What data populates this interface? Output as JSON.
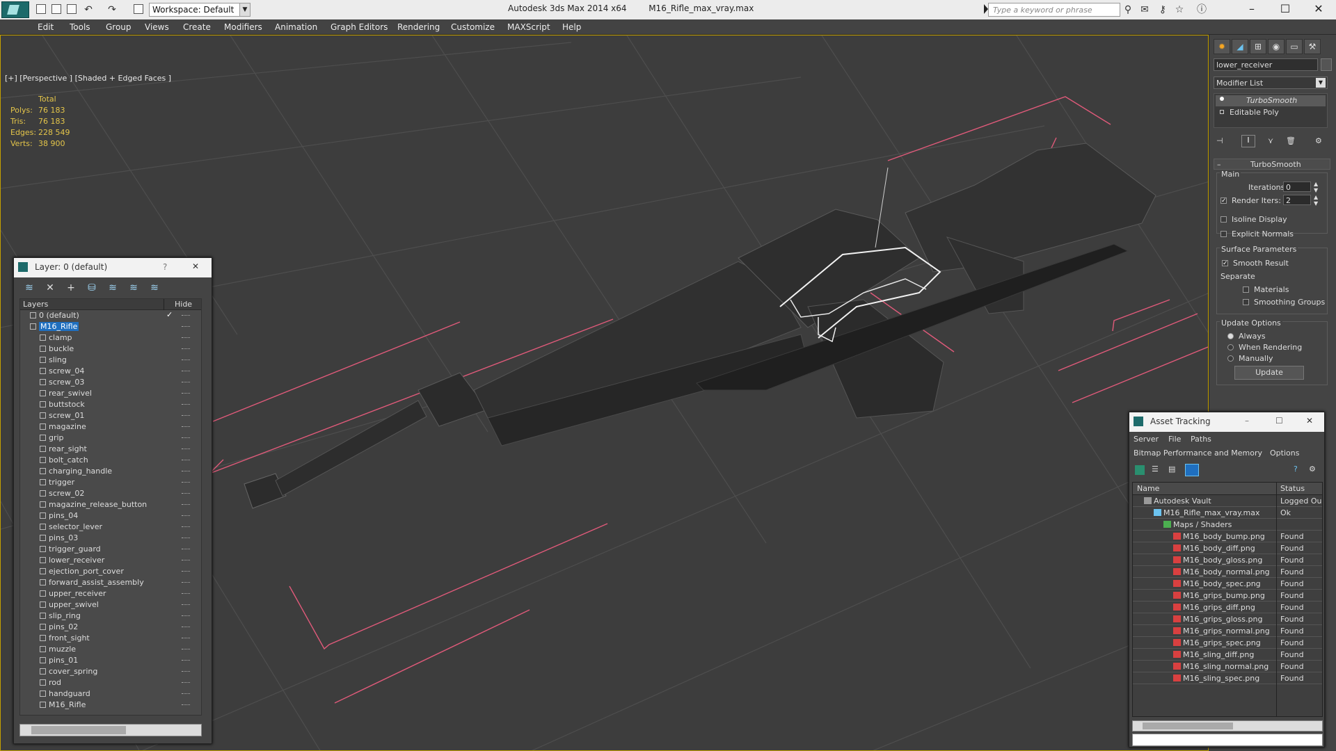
{
  "titlebar": {
    "workspace": "Workspace: Default",
    "app": "Autodesk 3ds Max  2014 x64",
    "file": "M16_Rifle_max_vray.max",
    "search_placeholder": "Type a keyword or phrase"
  },
  "menu": [
    "Edit",
    "Tools",
    "Group",
    "Views",
    "Create",
    "Modifiers",
    "Animation",
    "Graph Editors",
    "Rendering",
    "Customize",
    "MAXScript",
    "Help"
  ],
  "viewport": {
    "label": "[+] [Perspective ] [Shaded + Edged Faces ]",
    "stats": {
      "header": "Total",
      "rows": [
        {
          "label": "Polys:",
          "value": "76 183"
        },
        {
          "label": "Tris:",
          "value": "76 183"
        },
        {
          "label": "Edges:",
          "value": "228 549"
        },
        {
          "label": "Verts:",
          "value": "38 900"
        }
      ]
    }
  },
  "layer_manager": {
    "title": "Layer: 0 (default)",
    "help": "?",
    "close": "✕",
    "col_layers": "Layers",
    "col_hide": "Hide",
    "rows": [
      {
        "name": "0 (default)",
        "indent": 1,
        "check": "✓"
      },
      {
        "name": "M16_Rifle",
        "indent": 1,
        "selected": true
      },
      {
        "name": "clamp",
        "indent": 2
      },
      {
        "name": "buckle",
        "indent": 2
      },
      {
        "name": "sling",
        "indent": 2
      },
      {
        "name": "screw_04",
        "indent": 2
      },
      {
        "name": "screw_03",
        "indent": 2
      },
      {
        "name": "rear_swivel",
        "indent": 2
      },
      {
        "name": "buttstock",
        "indent": 2
      },
      {
        "name": "screw_01",
        "indent": 2
      },
      {
        "name": "magazine",
        "indent": 2
      },
      {
        "name": "grip",
        "indent": 2
      },
      {
        "name": "rear_sight",
        "indent": 2
      },
      {
        "name": "bolt_catch",
        "indent": 2
      },
      {
        "name": "charging_handle",
        "indent": 2
      },
      {
        "name": "trigger",
        "indent": 2
      },
      {
        "name": "screw_02",
        "indent": 2
      },
      {
        "name": "magazine_release_button",
        "indent": 2
      },
      {
        "name": "pins_04",
        "indent": 2
      },
      {
        "name": "selector_lever",
        "indent": 2
      },
      {
        "name": "pins_03",
        "indent": 2
      },
      {
        "name": "trigger_guard",
        "indent": 2
      },
      {
        "name": "lower_receiver",
        "indent": 2
      },
      {
        "name": "ejection_port_cover",
        "indent": 2
      },
      {
        "name": "forward_assist_assembly",
        "indent": 2
      },
      {
        "name": "upper_receiver",
        "indent": 2
      },
      {
        "name": "upper_swivel",
        "indent": 2
      },
      {
        "name": "slip_ring",
        "indent": 2
      },
      {
        "name": "pins_02",
        "indent": 2
      },
      {
        "name": "front_sight",
        "indent": 2
      },
      {
        "name": "muzzle",
        "indent": 2
      },
      {
        "name": "pins_01",
        "indent": 2
      },
      {
        "name": "cover_spring",
        "indent": 2
      },
      {
        "name": "rod",
        "indent": 2
      },
      {
        "name": "handguard",
        "indent": 2
      },
      {
        "name": "M16_Rifle",
        "indent": 2
      }
    ]
  },
  "command_panel": {
    "object_name": "lower_receiver",
    "modifier_list": "Modifier List",
    "stack": [
      "TurboSmooth",
      "Editable Poly"
    ],
    "rollout_title": "TurboSmooth",
    "main": "Main",
    "iterations_label": "Iterations:",
    "iterations_value": "0",
    "render_iters_label": "Render Iters:",
    "render_iters_value": "2",
    "isoline": "Isoline Display",
    "explicit_normals": "Explicit Normals",
    "surface_params": "Surface Parameters",
    "smooth_result": "Smooth Result",
    "separate": "Separate",
    "materials": "Materials",
    "smoothing_groups": "Smoothing Groups",
    "update_options": "Update Options",
    "always": "Always",
    "when_rendering": "When Rendering",
    "manually": "Manually",
    "update_btn": "Update"
  },
  "asset_tracking": {
    "title": "Asset Tracking",
    "menu1": [
      "Server",
      "File",
      "Paths"
    ],
    "menu2": [
      "Bitmap Performance and Memory",
      "Options"
    ],
    "col_name": "Name",
    "col_status": "Status",
    "rows": [
      {
        "name": "Autodesk Vault",
        "status": "Logged Ou",
        "indent": 0,
        "icon": "vault"
      },
      {
        "name": "M16_Rifle_max_vray.max",
        "status": "Ok",
        "indent": 1,
        "icon": "max"
      },
      {
        "name": "Maps / Shaders",
        "status": "",
        "indent": 2,
        "icon": "folder"
      },
      {
        "name": "M16_body_bump.png",
        "status": "Found",
        "indent": 3,
        "icon": "png"
      },
      {
        "name": "M16_body_diff.png",
        "status": "Found",
        "indent": 3,
        "icon": "png"
      },
      {
        "name": "M16_body_gloss.png",
        "status": "Found",
        "indent": 3,
        "icon": "png"
      },
      {
        "name": "M16_body_normal.png",
        "status": "Found",
        "indent": 3,
        "icon": "png"
      },
      {
        "name": "M16_body_spec.png",
        "status": "Found",
        "indent": 3,
        "icon": "png"
      },
      {
        "name": "M16_grips_bump.png",
        "status": "Found",
        "indent": 3,
        "icon": "png"
      },
      {
        "name": "M16_grips_diff.png",
        "status": "Found",
        "indent": 3,
        "icon": "png"
      },
      {
        "name": "M16_grips_gloss.png",
        "status": "Found",
        "indent": 3,
        "icon": "png"
      },
      {
        "name": "M16_grips_normal.png",
        "status": "Found",
        "indent": 3,
        "icon": "png"
      },
      {
        "name": "M16_grips_spec.png",
        "status": "Found",
        "indent": 3,
        "icon": "png"
      },
      {
        "name": "M16_sling_diff.png",
        "status": "Found",
        "indent": 3,
        "icon": "png"
      },
      {
        "name": "M16_sling_normal.png",
        "status": "Found",
        "indent": 3,
        "icon": "png"
      },
      {
        "name": "M16_sling_spec.png",
        "status": "Found",
        "indent": 3,
        "icon": "png"
      }
    ]
  },
  "colors": {
    "accent": "#1f6fbf",
    "viewport_border": "#c4a000",
    "stats": "#e4c54a",
    "gizmo": "#e05a7a",
    "wire": "#6a6a6a"
  }
}
